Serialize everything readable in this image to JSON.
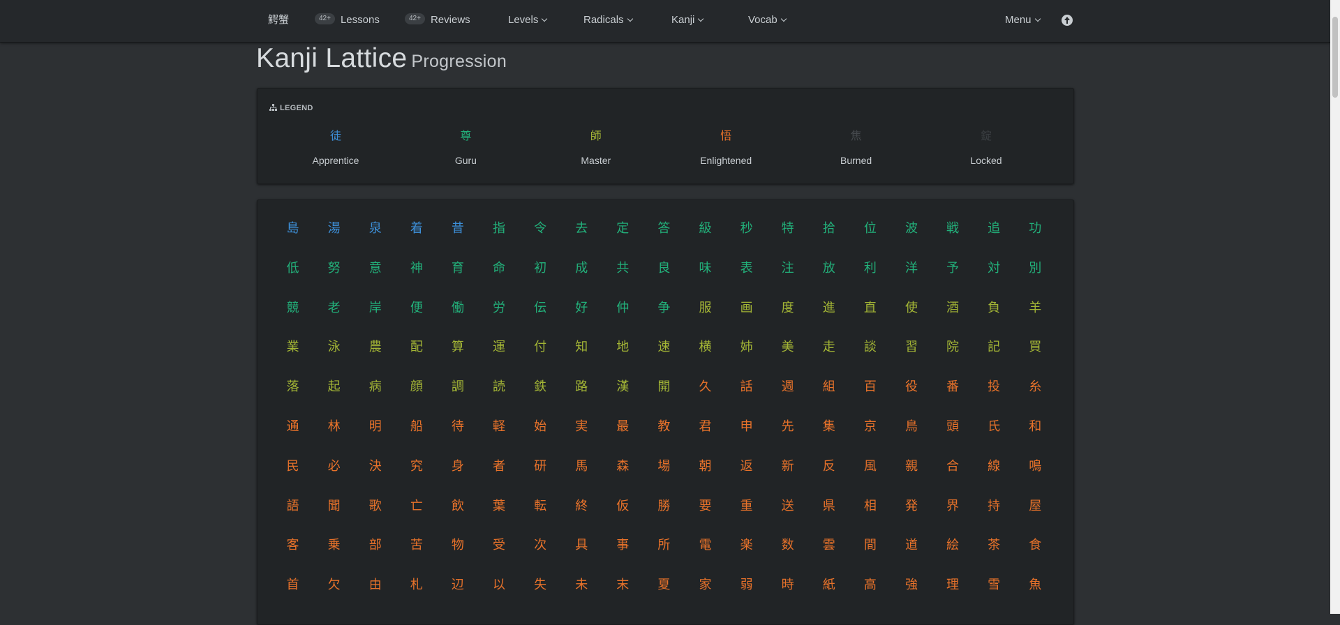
{
  "nav": {
    "brand": "鰐蟹",
    "lessons_badge": "42+",
    "lessons_label": "Lessons",
    "reviews_badge": "42+",
    "reviews_label": "Reviews",
    "levels_label": "Levels",
    "radicals_label": "Radicals",
    "kanji_label": "Kanji",
    "vocab_label": "Vocab",
    "menu_label": "Menu"
  },
  "page": {
    "title": "Kanji Lattice",
    "subtitle": "Progression"
  },
  "legend": {
    "heading": "LEGEND",
    "items": [
      {
        "kanji": "徒",
        "label": "Apprentice",
        "color": "#3d8fd8"
      },
      {
        "kanji": "尊",
        "label": "Guru",
        "color": "#22b07a"
      },
      {
        "kanji": "師",
        "label": "Master",
        "color": "#a3b535"
      },
      {
        "kanji": "悟",
        "label": "Enlightened",
        "color": "#e8722a"
      },
      {
        "kanji": "焦",
        "label": "Burned",
        "color": "#45494d"
      },
      {
        "kanji": "錠",
        "label": "Locked",
        "color": "#3a3e42"
      }
    ]
  },
  "colors": {
    "apprentice": "#3d8fd8",
    "guru": "#22b07a",
    "master": "#a3b535",
    "enlightened": "#e8722a",
    "burned": "#45494d",
    "locked": "#3a3e42"
  },
  "lattice": {
    "rows": [
      [
        "島",
        "湯",
        "泉",
        "着",
        "昔",
        "指",
        "令",
        "去",
        "定",
        "答",
        "級",
        "秒",
        "特",
        "拾",
        "位",
        "波",
        "戦",
        "追",
        "功"
      ],
      [
        "低",
        "努",
        "意",
        "神",
        "育",
        "命",
        "初",
        "成",
        "共",
        "良",
        "味",
        "表",
        "注",
        "放",
        "利",
        "洋",
        "予",
        "対",
        "別"
      ],
      [
        "競",
        "老",
        "岸",
        "便",
        "働",
        "労",
        "伝",
        "好",
        "仲",
        "争",
        "服",
        "画",
        "度",
        "進",
        "直",
        "使",
        "酒",
        "負",
        "羊"
      ],
      [
        "業",
        "泳",
        "農",
        "配",
        "算",
        "運",
        "付",
        "知",
        "地",
        "速",
        "横",
        "姉",
        "美",
        "走",
        "談",
        "習",
        "院",
        "記",
        "買"
      ],
      [
        "落",
        "起",
        "病",
        "顔",
        "調",
        "読",
        "鉄",
        "路",
        "漢",
        "開",
        "久",
        "話",
        "週",
        "組",
        "百",
        "役",
        "番",
        "投",
        "糸"
      ],
      [
        "通",
        "林",
        "明",
        "船",
        "待",
        "軽",
        "始",
        "実",
        "最",
        "教",
        "君",
        "申",
        "先",
        "集",
        "京",
        "鳥",
        "頭",
        "氏",
        "和"
      ],
      [
        "民",
        "必",
        "決",
        "究",
        "身",
        "者",
        "研",
        "馬",
        "森",
        "場",
        "朝",
        "返",
        "新",
        "反",
        "風",
        "親",
        "合",
        "線",
        "鳴"
      ],
      [
        "語",
        "聞",
        "歌",
        "亡",
        "飲",
        "葉",
        "転",
        "終",
        "仮",
        "勝",
        "要",
        "重",
        "送",
        "県",
        "相",
        "発",
        "界",
        "持",
        "屋"
      ],
      [
        "客",
        "乗",
        "部",
        "苦",
        "物",
        "受",
        "次",
        "具",
        "事",
        "所",
        "電",
        "楽",
        "数",
        "雲",
        "間",
        "道",
        "絵",
        "茶",
        "食"
      ],
      [
        "首",
        "欠",
        "由",
        "札",
        "辺",
        "以",
        "失",
        "未",
        "末",
        "夏",
        "家",
        "弱",
        "時",
        "紙",
        "高",
        "強",
        "理",
        "雪",
        "魚"
      ]
    ],
    "stages": [
      "AAAAAGGGGGGGGGGGGGG",
      "GGGGGGGGGGGGGGGGGGG",
      "GGGGGGGGGGMMMMMMMMM",
      "MMMMMMMMMMMMMMMMMMM",
      "MMMMMMMMMMEEEEEEEEE",
      "EEEEEEEEEEEEEEEEEEE",
      "EEEEEEEEEEEEEEEEEEE",
      "EEEEEEEEEEEEEEEEEEE",
      "EEEEEEEEEEEEEEEEEEE",
      "EEEEEEEEEEEEEEEEEEE"
    ]
  }
}
